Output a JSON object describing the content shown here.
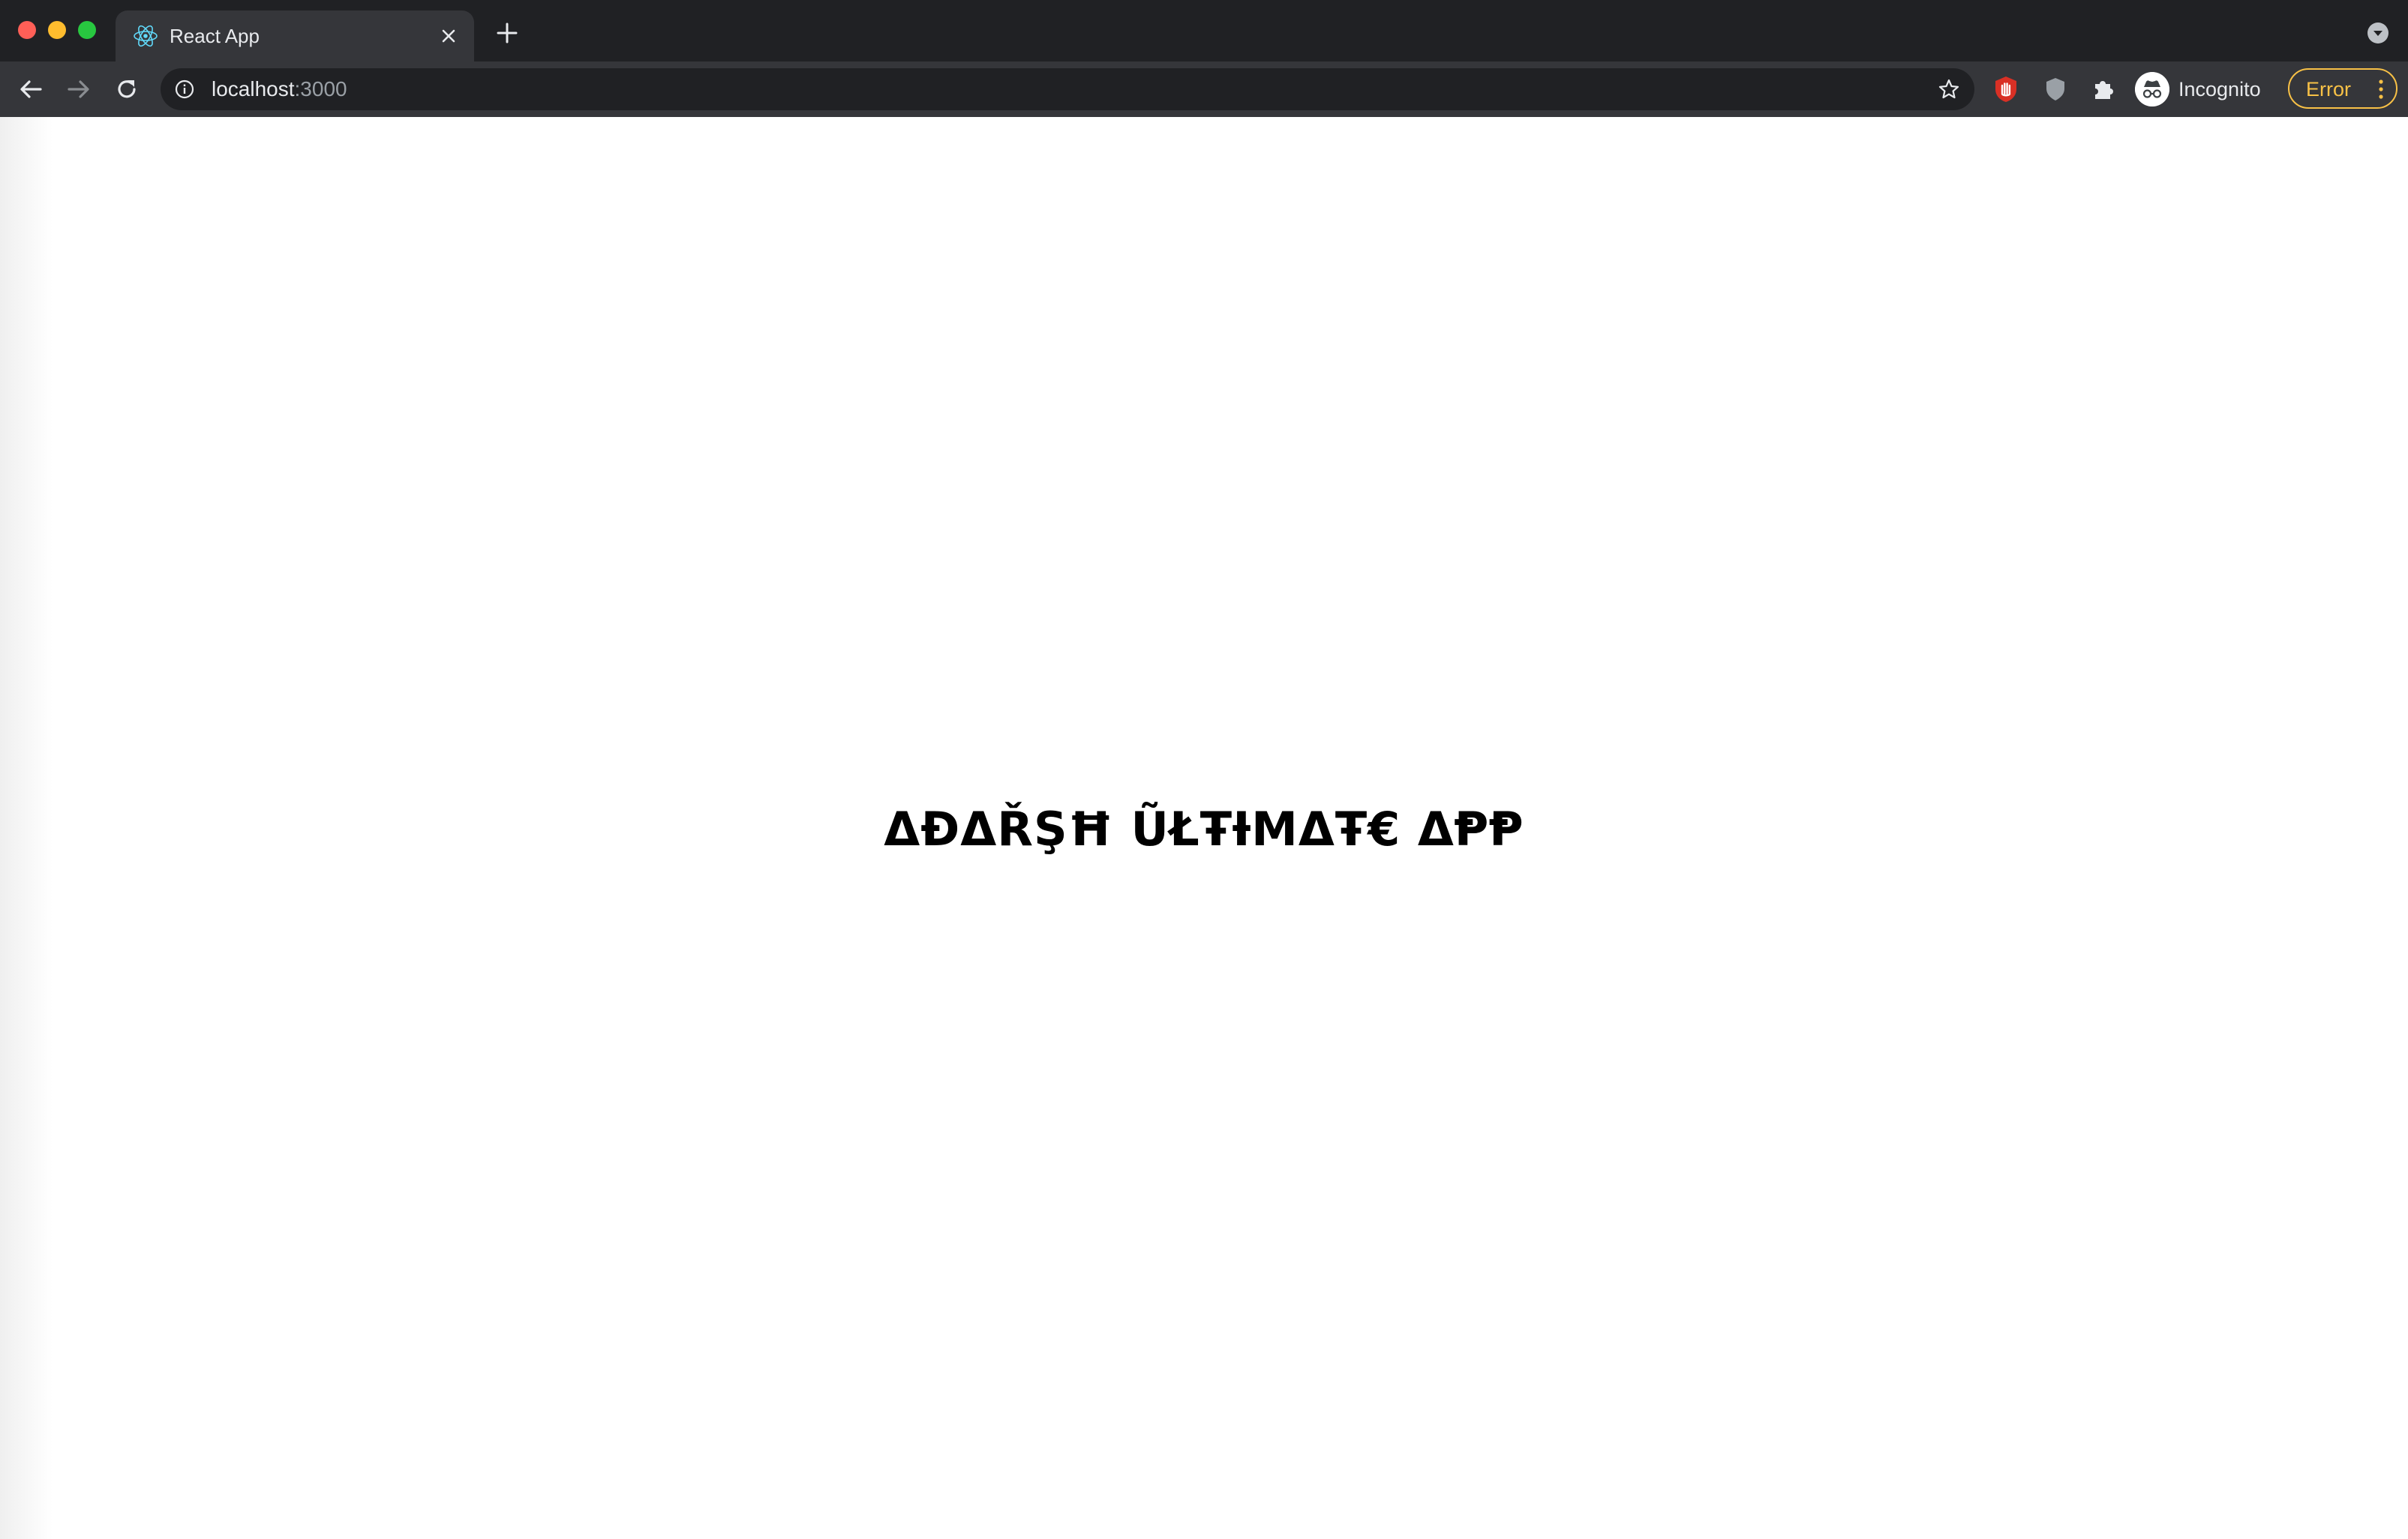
{
  "window": {
    "controls": [
      "close",
      "minimize",
      "zoom"
    ]
  },
  "tabs": [
    {
      "title": "React App",
      "favicon": "react-logo-icon",
      "active": true
    }
  ],
  "toolbar": {
    "url_host": "localhost",
    "url_port": ":3000",
    "profile_label": "Incognito",
    "error_label": "Error",
    "extensions": [
      "red-hand-extension-icon",
      "shield-extension-icon",
      "puzzle-extensions-icon"
    ]
  },
  "page": {
    "heading": "ΔĐΔŘŞĦ ŨŁŦƗMΔŦ€ ΔⱣⱣ"
  },
  "colors": {
    "frame": "#202124",
    "toolbar": "#35363a",
    "error_accent": "#f8c146",
    "react_blue": "#61dafb"
  }
}
